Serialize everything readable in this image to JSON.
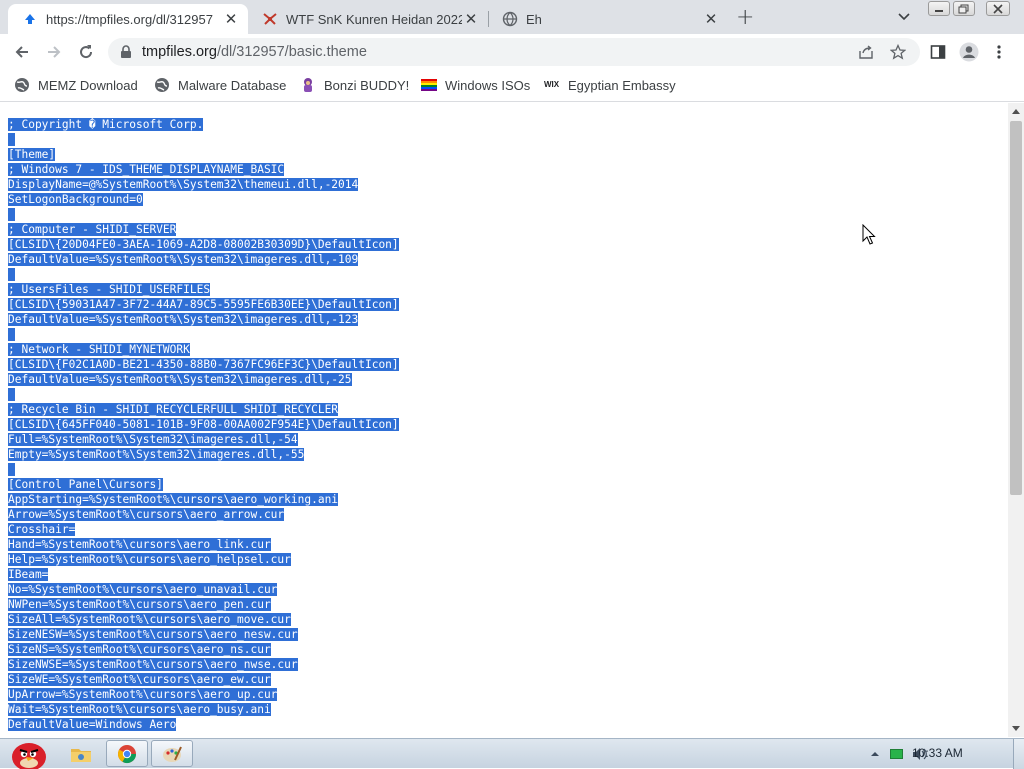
{
  "browser": {
    "tabs": [
      {
        "title": "https://tmpfiles.org/dl/312957",
        "icon": "tmpfiles-icon",
        "active": true
      },
      {
        "title": "WTF SnK Kunren Heidan 2022",
        "icon": "red-emblem-icon",
        "active": false
      },
      {
        "title": "Eh",
        "icon": "globe-icon",
        "active": false
      }
    ],
    "new_tab_label": "+",
    "address": {
      "host": "tmpfiles.org",
      "path": "/dl/312957/basic.theme"
    },
    "bookmarks": [
      {
        "label": "MEMZ Download",
        "icon": "globe-icon"
      },
      {
        "label": "Malware Database",
        "icon": "globe-icon"
      },
      {
        "label": "Bonzi BUDDY!",
        "icon": "bonzi-icon"
      },
      {
        "label": "Windows ISOs",
        "icon": "rainbow-flag-icon"
      },
      {
        "label": "Egyptian Embassy",
        "icon": "wix-icon"
      }
    ]
  },
  "file_lines": [
    "; Copyright � Microsoft Corp.",
    "",
    "[Theme]",
    "; Windows 7 - IDS_THEME_DISPLAYNAME_BASIC",
    "DisplayName=@%SystemRoot%\\System32\\themeui.dll,-2014",
    "SetLogonBackground=0",
    "",
    "; Computer - SHIDI_SERVER",
    "[CLSID\\{20D04FE0-3AEA-1069-A2D8-08002B30309D}\\DefaultIcon]",
    "DefaultValue=%SystemRoot%\\System32\\imageres.dll,-109",
    "",
    "; UsersFiles - SHIDI_USERFILES",
    "[CLSID\\{59031A47-3F72-44A7-89C5-5595FE6B30EE}\\DefaultIcon]",
    "DefaultValue=%SystemRoot%\\System32\\imageres.dll,-123",
    "",
    "; Network - SHIDI_MYNETWORK",
    "[CLSID\\{F02C1A0D-BE21-4350-88B0-7367FC96EF3C}\\DefaultIcon]",
    "DefaultValue=%SystemRoot%\\System32\\imageres.dll,-25",
    "",
    "; Recycle Bin - SHIDI_RECYCLERFULL SHIDI_RECYCLER",
    "[CLSID\\{645FF040-5081-101B-9F08-00AA002F954E}\\DefaultIcon]",
    "Full=%SystemRoot%\\System32\\imageres.dll,-54",
    "Empty=%SystemRoot%\\System32\\imageres.dll,-55",
    "",
    "[Control Panel\\Cursors]",
    "AppStarting=%SystemRoot%\\cursors\\aero_working.ani",
    "Arrow=%SystemRoot%\\cursors\\aero_arrow.cur",
    "Crosshair=",
    "Hand=%SystemRoot%\\cursors\\aero_link.cur",
    "Help=%SystemRoot%\\cursors\\aero_helpsel.cur",
    "IBeam=",
    "No=%SystemRoot%\\cursors\\aero_unavail.cur",
    "NWPen=%SystemRoot%\\cursors\\aero_pen.cur",
    "SizeAll=%SystemRoot%\\cursors\\aero_move.cur",
    "SizeNESW=%SystemRoot%\\cursors\\aero_nesw.cur",
    "SizeNS=%SystemRoot%\\cursors\\aero_ns.cur",
    "SizeNWSE=%SystemRoot%\\cursors\\aero_nwse.cur",
    "SizeWE=%SystemRoot%\\cursors\\aero_ew.cur",
    "UpArrow=%SystemRoot%\\cursors\\aero_up.cur",
    "Wait=%SystemRoot%\\cursors\\aero_busy.ani",
    "DefaultValue=Windows Aero"
  ],
  "taskbar": {
    "apps": [
      {
        "name": "angry-bird-start-icon"
      },
      {
        "name": "file-explorer-icon"
      },
      {
        "name": "chrome-icon"
      },
      {
        "name": "paint-icon"
      }
    ],
    "clock": "10:33 AM"
  },
  "colors": {
    "selection": "#2f6fd6",
    "tabstrip": "#dee1e6",
    "taskbar": "#c6d3e0"
  }
}
